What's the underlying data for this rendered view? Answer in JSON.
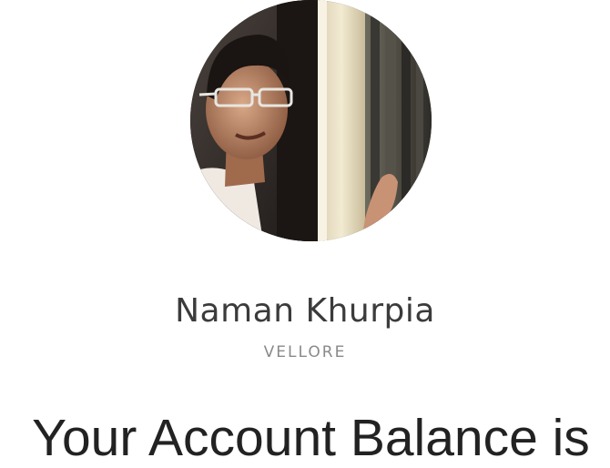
{
  "profile": {
    "avatar_icon": "profile-photo",
    "name": "Naman Khurpia",
    "location": "VELLORE"
  },
  "account": {
    "heading": "Your Account Balance is"
  },
  "colors": {
    "background": "#ffffff",
    "name_text": "#3b3b3b",
    "location_text": "#8a8a8a",
    "heading_text": "#222222"
  }
}
